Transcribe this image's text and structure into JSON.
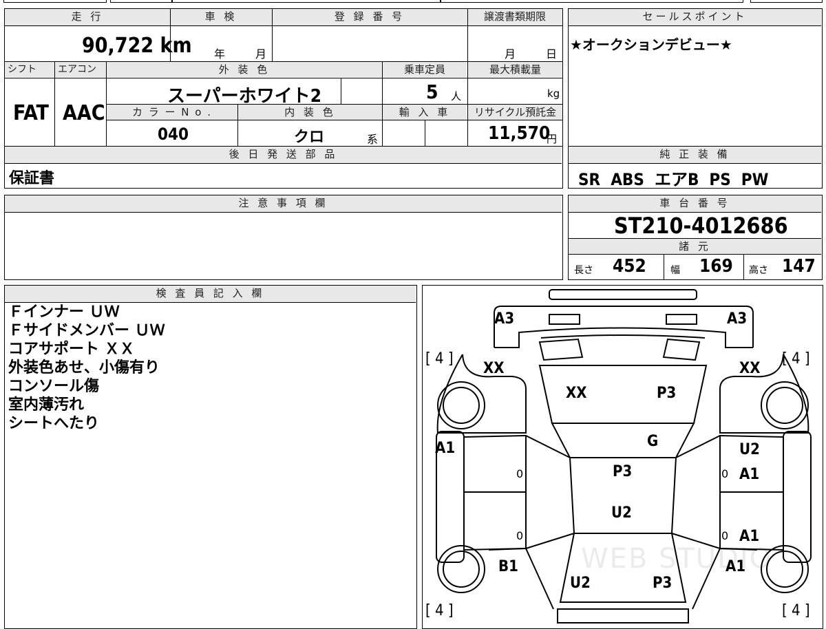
{
  "headers": {
    "mileage": "走 行",
    "inspection": "車 検",
    "registration": "登 録 番 号",
    "transfer_deadline": "譲渡書類期限",
    "sales_point": "セールスポイント",
    "shift": "シフト",
    "aircon": "エアコン",
    "exterior_color": "外 装 色",
    "capacity": "乗車定員",
    "max_load": "最大積載量",
    "color_no": "カ ラ ー N o .",
    "interior_color": "内 装 色",
    "import": "輸 入 車",
    "recycle": "リサイクル預託金",
    "later_parts": "後 日 発 送 部 品",
    "genuine_equipment": "純 正 装 備",
    "notes": "注 意 事 項 欄",
    "chassis_no": "車 台 番 号",
    "specs": "諸 元",
    "inspector": "検 査 員 記 入 欄"
  },
  "values": {
    "mileage": "90,722",
    "mileage_unit": "km",
    "year_unit": "年",
    "month_unit": "月",
    "day_unit": "日",
    "sales_point": "★オークションデビュー★",
    "shift": "FAT",
    "aircon": "AAC",
    "exterior_color": "スーパーホワイト2",
    "capacity": "5",
    "capacity_unit": "人",
    "max_load_unit": "kg",
    "color_no": "040",
    "interior_color": "クロ",
    "interior_suffix": "系",
    "recycle": "11,570",
    "recycle_unit": "円",
    "later_parts": "保証書",
    "genuine_equipment": "SR  ABS  エアB  PS  PW",
    "chassis_no": "ST210-4012686",
    "length_label": "長さ",
    "length": "452",
    "width_label": "幅",
    "width": "169",
    "height_label": "高さ",
    "height": "147"
  },
  "inspector_notes": [
    "Ｆインナー ＵＷ",
    "Ｆサイドメンバー ＵＷ",
    "コアサポート ＸＸ",
    "外装色あせ、小傷有り",
    "コンソール傷",
    "室内薄汚れ",
    "シートへたり"
  ],
  "diagram_marks": {
    "front_left_a3": "A3",
    "front_right_a3": "A3",
    "tire_fl": "[ 4 ]",
    "tire_fr": "[ 4 ]",
    "tire_rl": "[ 4 ]",
    "tire_rr": "[ 4 ]",
    "fender_fl": "XX",
    "fender_fr": "XX",
    "hood_left": "XX",
    "hood_right": "P3",
    "windshield": "G",
    "door_fl": "A1",
    "door_fr_top": "U2",
    "door_fr": "A1",
    "door_rr": "A1",
    "roof_top": "P3",
    "roof_bottom": "U2",
    "quarter_rl": "B1",
    "quarter_rr": "A1",
    "trunk_left": "U2",
    "trunk_right": "P3",
    "zero_1": "0",
    "zero_2": "0",
    "zero_3": "0",
    "zero_4": "0"
  },
  "watermark": "WEB STUDIO"
}
